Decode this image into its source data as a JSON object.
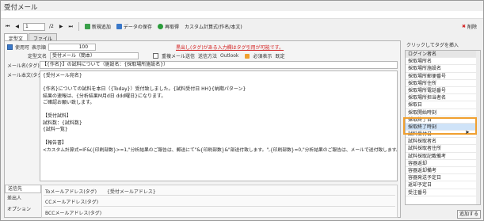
{
  "window": {
    "title": "受付メール"
  },
  "toolbar": {
    "page_current": "1",
    "page_total": "/2",
    "items": [
      "新規追加",
      "データの保存",
      "再取得",
      "カスタム計算式(作名/本文)"
    ],
    "delete_label": "削除"
  },
  "tabs": [
    "定型文",
    "ファイル"
  ],
  "template_row": {
    "use_checkbox_label": "使用可",
    "display_order_label": "表示順",
    "display_order_value": "100",
    "warning": "黒出し(タグ)がある入力欄はタグ引用が可能です。"
  },
  "settings_row": {
    "name_label": "定型文名",
    "name_value": "受付メール（簡本）",
    "dup_checkbox_label": "重複メール送信",
    "send_method_label": "送信方法",
    "send_method_value": "Outlook",
    "importance_label": "必須表示",
    "importance_value": "既定"
  },
  "subject": {
    "label": "メール名(タグ)",
    "value": "【{作名}】の試料について（施設名：{採取場所施設名}）"
  },
  "body": {
    "label": "メール本文(タグ)",
    "lines": [
      "{受付メール宛名}",
      "",
      "{作名}についての試料を本日（{Today}）受付致しました。{試料受付日 HH}{納期パターン}",
      "結果の速報は、{分析結果M月d日 ddd曜日}になります。",
      "ご確認お願い致します。",
      "",
      "【受付試料】",
      "試料数：{試料数}",
      "{試料一覧}",
      "",
      "【報告書】",
      "<カスタム計算式=IF&({印刷部数}>=1,\"分析結果のご報告は、郵送にて\"&{印刷部数}&\"部送付致します。\",{印刷部数}=0,\"分析結果のご報告は、メールで送付致します。\")カスタム計算式>"
    ]
  },
  "recipients": {
    "tabs": [
      "送信先",
      "差出人",
      "オプション"
    ],
    "to_label": "Toメールアドレス(タグ)",
    "to_value": "{受付メールアドレス}",
    "cc_label": "CCメールアドレス(タグ)",
    "bcc_label": "BCCメールアドレス(タグ)"
  },
  "tag_panel": {
    "header": "クリックしてタグを挿入",
    "items": [
      "ログイン者名",
      "採取場所名",
      "採取場所施設名",
      "採取場所郵便番号",
      "採取場所住所",
      "採取場所電話番号",
      "採取場所担当者名",
      "採取日",
      "採取開始時刻",
      "採取終了日",
      "採取終了時刻",
      "試料受付日",
      "試料採取者名",
      "試料採取者住所",
      "試料採取記載備考",
      "容器返却",
      "容器返却備考",
      "容器発送予定日",
      "返却予定日",
      "受注番号"
    ],
    "selected_index": 10,
    "add_button": "追加する"
  },
  "colors": {
    "accent_blue": "#3a78c9",
    "highlight_orange": "#f0a030",
    "warning_red": "#d42020",
    "selection": "#cfe3f8"
  }
}
